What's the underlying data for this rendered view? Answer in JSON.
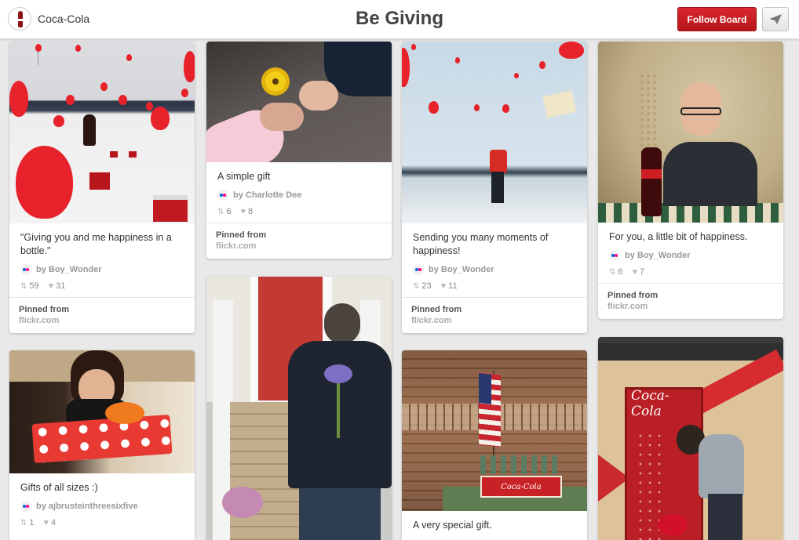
{
  "header": {
    "brand_name": "Coca-Cola",
    "board_title": "Be Giving",
    "follow_label": "Follow Board"
  },
  "colors": {
    "accent": "#cb2027",
    "flickr_blue": "#0063dc",
    "flickr_pink": "#ff0084"
  },
  "icons": {
    "send": "send-icon",
    "repin": "repin-icon",
    "like": "heart-icon",
    "pinner": "flickr-icon"
  },
  "pins": [
    {
      "description": "\"Giving you and me happiness in a bottle.\"",
      "pinner": "by Boy_Wonder",
      "repins": "59",
      "likes": "31",
      "pinned_from_label": "Pinned from",
      "source": "flickr.com"
    },
    {
      "description": "A simple gift",
      "pinner": "by Charlotte Dee",
      "repins": "6",
      "likes": "8",
      "pinned_from_label": "Pinned from",
      "source": "flickr.com"
    },
    {
      "description": "Sending you many moments of happiness!",
      "pinner": "by Boy_Wonder",
      "repins": "23",
      "likes": "11",
      "pinned_from_label": "Pinned from",
      "source": "flickr.com"
    },
    {
      "description": "For you, a little bit of happiness.",
      "pinner": "by Boy_Wonder",
      "repins": "6",
      "likes": "7",
      "pinned_from_label": "Pinned from",
      "source": "flickr.com"
    },
    {
      "description": "Gifts of all sizes :)",
      "pinner": "by ajbrusteinthreesixfive",
      "repins": "1",
      "likes": "4"
    },
    {
      "description": "A very special gift."
    }
  ],
  "image_text": {
    "coca_cola_logo": "Coca-Cola"
  }
}
